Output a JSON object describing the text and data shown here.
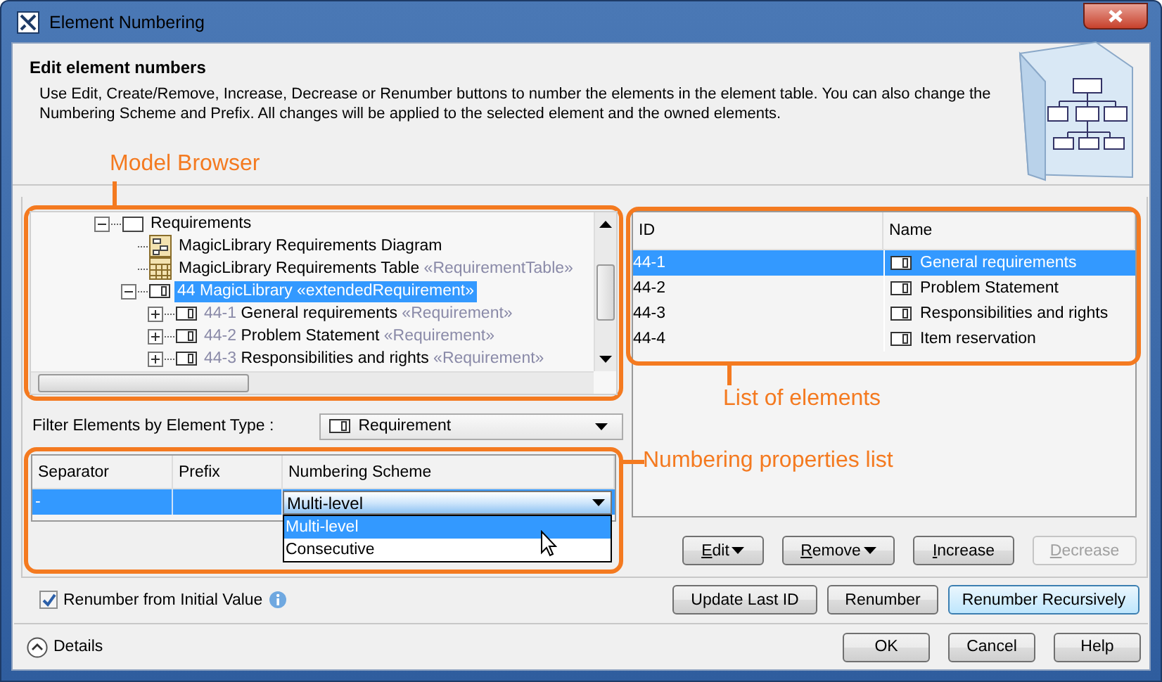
{
  "window": {
    "title": "Element Numbering"
  },
  "header": {
    "title": "Edit element numbers",
    "description": "Use Edit, Create/Remove, Increase, Decrease or Renumber buttons to number the elements in the element table. You can also change the Numbering Scheme and Prefix. All changes will be applied to the selected element and the owned elements."
  },
  "model_browser": {
    "callout": "Model Browser",
    "tree": [
      {
        "label": "Requirements",
        "kind": "package",
        "expanded": true,
        "selected": false,
        "children": [
          {
            "label": "MagicLibrary Requirements Diagram",
            "kind": "diagram",
            "selected": false
          },
          {
            "label": "MagicLibrary Requirements Table",
            "stereotype": "«RequirementTable»",
            "kind": "table",
            "selected": false
          },
          {
            "number": "44",
            "label": "MagicLibrary",
            "stereotype": "«extendedRequirement»",
            "kind": "requirement",
            "expanded": true,
            "selected": true,
            "children": [
              {
                "number": "44-1",
                "label": "General requirements",
                "stereotype": "«Requirement»",
                "kind": "requirement",
                "expanded": false,
                "selected": false
              },
              {
                "number": "44-2",
                "label": "Problem Statement",
                "stereotype": "«Requirement»",
                "kind": "requirement",
                "expanded": false,
                "selected": false
              },
              {
                "number": "44-3",
                "label": "Responsibilities and rights",
                "stereotype": "«Requirement»",
                "kind": "requirement",
                "expanded": false,
                "selected": false
              }
            ]
          }
        ]
      }
    ]
  },
  "filter": {
    "label": "Filter Elements by Element Type :",
    "value": "Requirement"
  },
  "properties": {
    "callout": "Numbering properties list",
    "columns": [
      "Separator",
      "Prefix",
      "Numbering Scheme"
    ],
    "rows": [
      {
        "separator": "-",
        "scheme": "Multi-level",
        "selected": true
      }
    ],
    "scheme_options": [
      {
        "label": "Multi-level",
        "selected": true
      },
      {
        "label": "Consecutive",
        "selected": false
      }
    ]
  },
  "renumber_from_initial": {
    "label": "Renumber from Initial Value",
    "checked": true
  },
  "element_list": {
    "callout": "List of elements",
    "columns": [
      "ID",
      "Name"
    ],
    "rows": [
      {
        "id": "44-1",
        "name": "General requirements",
        "selected": true
      },
      {
        "id": "44-2",
        "name": "Problem Statement",
        "selected": false
      },
      {
        "id": "44-3",
        "name": "Responsibilities and rights",
        "selected": false
      },
      {
        "id": "44-4",
        "name": "Item reservation",
        "selected": false
      }
    ]
  },
  "edit_buttons": [
    {
      "label": "Edit",
      "menu": true,
      "disabled": false
    },
    {
      "label": "Remove",
      "menu": true,
      "disabled": false
    },
    {
      "label": "Increase",
      "menu": false,
      "disabled": false
    },
    {
      "label": "Decrease",
      "menu": false,
      "disabled": true
    }
  ],
  "action_buttons": [
    {
      "label": "Update Last ID",
      "default": false
    },
    {
      "label": "Renumber",
      "default": false
    },
    {
      "label": "Renumber Recursively",
      "default": true
    }
  ],
  "details": {
    "label": "Details"
  },
  "dialog_buttons": [
    "OK",
    "Cancel",
    "Help"
  ]
}
